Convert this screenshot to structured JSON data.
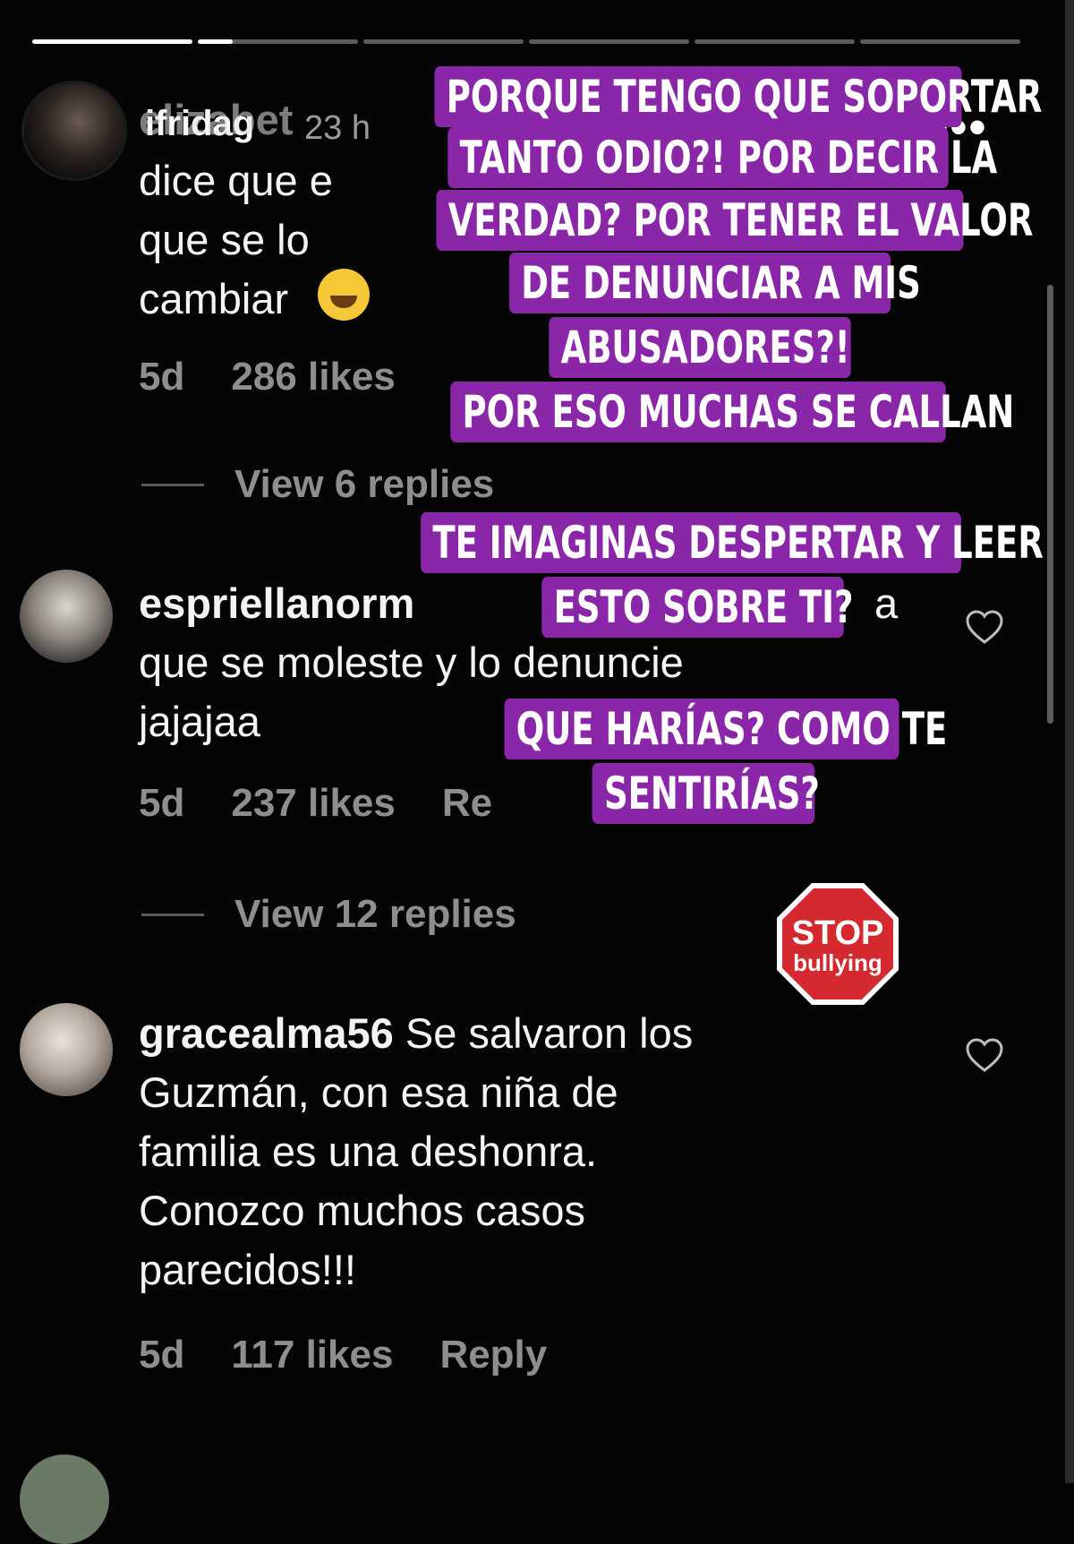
{
  "story": {
    "username": "ifridag",
    "time": "23 h",
    "progress": [
      1,
      0.22,
      0,
      0,
      0,
      0
    ]
  },
  "comments": [
    {
      "username": "elizabet",
      "text": "dice que e",
      "text2": "que se lo",
      "text3": "cambiar",
      "age": "5d",
      "likes": "286 likes",
      "view_replies": "View 6 replies"
    },
    {
      "username": "espriellanorm",
      "text_tail": "a",
      "text2": "que se moleste y lo denuncie",
      "text3": "jajajaa",
      "age": "5d",
      "likes": "237 likes",
      "reply": "Re",
      "view_replies": "View 12 replies"
    },
    {
      "username": "gracealma56",
      "text": "Se salvaron los",
      "text2": "Guzmán, con esa niña de",
      "text3": "familia es una deshonra.",
      "text4": "Conozco muchos casos",
      "text5": "parecidos!!!",
      "age": "5d",
      "likes": "117 likes",
      "reply": "Reply"
    }
  ],
  "stickers": {
    "block1": [
      "PORQUE TENGO QUE SOPORTAR",
      "TANTO ODIO?! POR DECIR LA",
      "VERDAD? POR TENER EL VALOR",
      "DE DENUNCIAR A MIS",
      "ABUSADORES?!",
      "POR ESO MUCHAS SE CALLAN"
    ],
    "block2": [
      "TE IMAGINAS DESPERTAR Y LEER",
      "ESTO SOBRE TI?"
    ],
    "block3": [
      "QUE HARÍAS? COMO TE",
      "SENTIRÍAS?"
    ],
    "stop": {
      "line1": "STOP",
      "line2": "bullying"
    }
  },
  "colors": {
    "sticker_bg": "#8a27a8",
    "stop_red": "#d42a2f",
    "meta_gray": "#8e8e8e"
  },
  "icons": [
    "pause-icon",
    "mute-icon",
    "more-icon",
    "heart-icon"
  ]
}
